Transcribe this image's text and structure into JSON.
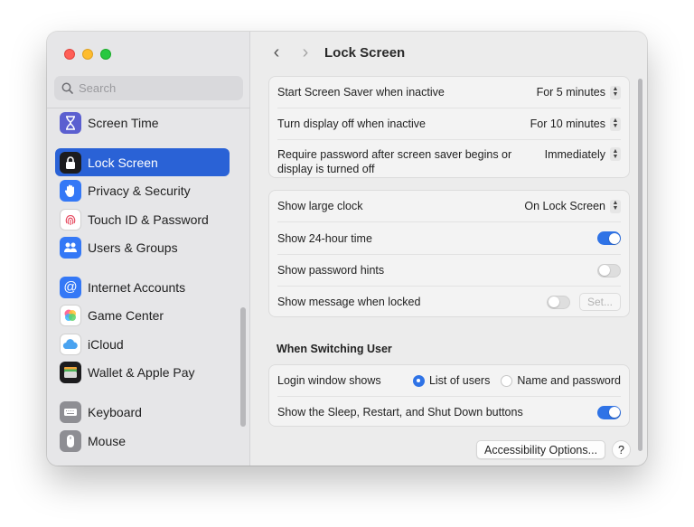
{
  "window": {
    "title": "Lock Screen"
  },
  "sidebar": {
    "search_placeholder": "Search",
    "items": [
      {
        "label": "Screen Time",
        "icon": "hourglass-icon",
        "color": "#5b5fd0"
      },
      {
        "label": "Lock Screen",
        "icon": "lock-icon",
        "color": "#1c1c1e",
        "active": true
      },
      {
        "label": "Privacy & Security",
        "icon": "hand-icon",
        "color": "#3478f6"
      },
      {
        "label": "Touch ID & Password",
        "icon": "fingerprint-icon",
        "color": "#ffffff"
      },
      {
        "label": "Users & Groups",
        "icon": "users-icon",
        "color": "#3478f6"
      },
      {
        "label": "Internet Accounts",
        "icon": "at-icon",
        "color": "#3478f6"
      },
      {
        "label": "Game Center",
        "icon": "game-center-icon",
        "color": "#ffffff"
      },
      {
        "label": "iCloud",
        "icon": "cloud-icon",
        "color": "#ffffff"
      },
      {
        "label": "Wallet & Apple Pay",
        "icon": "wallet-icon",
        "color": "#1c1c1e"
      },
      {
        "label": "Keyboard",
        "icon": "keyboard-icon",
        "color": "#8e8e93"
      },
      {
        "label": "Mouse",
        "icon": "mouse-icon",
        "color": "#8e8e93"
      }
    ]
  },
  "main": {
    "nav_back": "‹",
    "nav_forward": "›",
    "group1": {
      "rows": [
        {
          "label": "Start Screen Saver when inactive",
          "value": "For 5 minutes"
        },
        {
          "label": "Turn display off when inactive",
          "value": "For 10 minutes"
        },
        {
          "label": "Require password after screen saver begins or display is turned off",
          "value": "Immediately"
        }
      ]
    },
    "group2": {
      "clock_label": "Show large clock",
      "clock_value": "On Lock Screen",
      "time24_label": "Show 24-hour time",
      "time24_on": true,
      "hints_label": "Show password hints",
      "hints_on": false,
      "message_label": "Show message when locked",
      "message_on": false,
      "set_button": "Set..."
    },
    "switching_heading": "When Switching User",
    "group3": {
      "login_label": "Login window shows",
      "option_list": "List of users",
      "option_name": "Name and password",
      "selected": "List of users",
      "sleep_label": "Show the Sleep, Restart, and Shut Down buttons",
      "sleep_on": true
    },
    "accessibility_button": "Accessibility Options...",
    "help_button": "?"
  },
  "colors": {
    "accent": "#2f73e6",
    "sidebar_selection": "#2a62d6"
  }
}
